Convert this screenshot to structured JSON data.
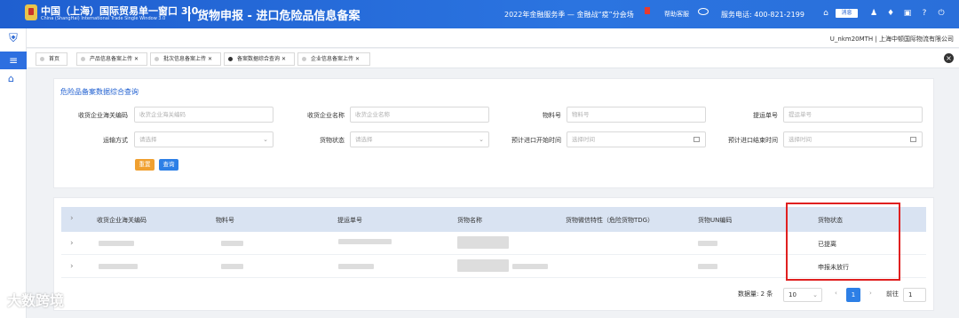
{
  "header": {
    "brand_title": "中国（上海）国际贸易单一窗口 3.0",
    "brand_sub": "China (ShangHai) International Trade Single Window 3.0",
    "page_title": "货物申报 - 进口危险品信息备案",
    "promo": "2022年金融服务季 — 金融战“疫”分会场",
    "help": "帮助客服",
    "phone": "服务电话: 400-821-2199",
    "badge": "消息"
  },
  "user": "U_nkm20MTH | 上海中顿国际物流有限公司",
  "tabs": [
    {
      "label": "首页",
      "active": false,
      "closable": false
    },
    {
      "label": "产品信息备案上传",
      "active": false,
      "closable": true
    },
    {
      "label": "批次信息备案上传",
      "active": false,
      "closable": true
    },
    {
      "label": "备案数据综合查询",
      "active": true,
      "closable": true
    },
    {
      "label": "企业信息备案上传",
      "active": false,
      "closable": true
    }
  ],
  "search": {
    "title": "危险品备案数据综合查询",
    "fields": [
      {
        "label": "收货企业海关编码",
        "placeholder": "收货企业海关编码"
      },
      {
        "label": "收货企业名称",
        "placeholder": "收货企业名称"
      },
      {
        "label": "物料号",
        "placeholder": "物料号"
      },
      {
        "label": "提运单号",
        "placeholder": "提运单号"
      },
      {
        "label": "运输方式",
        "placeholder": "请选择"
      },
      {
        "label": "货物状态",
        "placeholder": "请选择"
      },
      {
        "label": "预计进口开始时间",
        "placeholder": "选择时间"
      },
      {
        "label": "预计进口结束时间",
        "placeholder": "选择时间"
      }
    ],
    "reset_label": "重置",
    "query_label": "查询"
  },
  "table": {
    "columns": [
      "收货企业海关编码",
      "物料号",
      "提运单号",
      "货物名称",
      "货物微信特性（危险货物TDG）",
      "货物UN编码",
      "货物状态"
    ],
    "rows": [
      {
        "status": "已提离"
      },
      {
        "status": "申报未放行"
      }
    ]
  },
  "pager": {
    "total_label": "数据量: 2 条",
    "page_size": "10",
    "current_page": "1",
    "goto_label": "前往",
    "goto_value": "1"
  },
  "watermark": "大数跨境",
  "colors": {
    "brand": "#1f5fd0",
    "accent": "#2d7fe6",
    "highlight": "#e02020",
    "reset": "#f0a030"
  }
}
